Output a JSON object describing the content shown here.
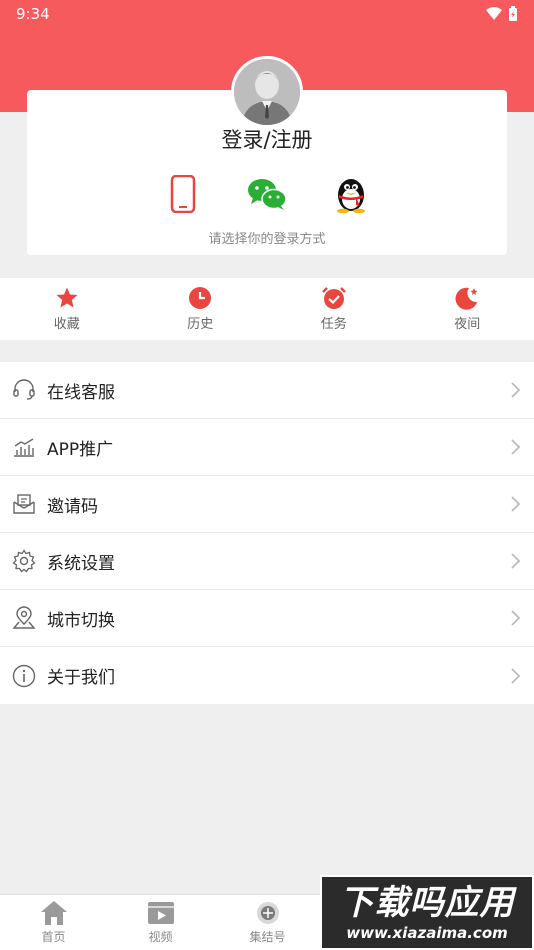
{
  "status_bar": {
    "time": "9:34"
  },
  "login": {
    "title": "登录/注册",
    "hint": "请选择你的登录方式",
    "methods": [
      {
        "icon": "phone-icon"
      },
      {
        "icon": "wechat-icon"
      },
      {
        "icon": "qq-icon"
      }
    ]
  },
  "quick": [
    {
      "label": "收藏",
      "icon": "star-icon"
    },
    {
      "label": "历史",
      "icon": "clock-icon"
    },
    {
      "label": "任务",
      "icon": "alarm-icon"
    },
    {
      "label": "夜间",
      "icon": "moon-icon"
    }
  ],
  "menu": [
    {
      "label": "在线客服",
      "icon": "headset-icon"
    },
    {
      "label": "APP推广",
      "icon": "chart-icon"
    },
    {
      "label": "邀请码",
      "icon": "envelope-icon"
    },
    {
      "label": "系统设置",
      "icon": "gear-icon"
    },
    {
      "label": "城市切换",
      "icon": "location-icon"
    },
    {
      "label": "关于我们",
      "icon": "info-icon"
    }
  ],
  "tabs": [
    {
      "label": "首页",
      "icon": "home-icon"
    },
    {
      "label": "视频",
      "icon": "video-icon"
    },
    {
      "label": "集结号",
      "icon": "badge-icon"
    }
  ],
  "watermark": {
    "title": "下载吗应用",
    "url": "www.xiazaima.com"
  },
  "colors": {
    "primary": "#f75a5c",
    "icon_red": "#e9463f",
    "wechat": "#2aae36"
  }
}
